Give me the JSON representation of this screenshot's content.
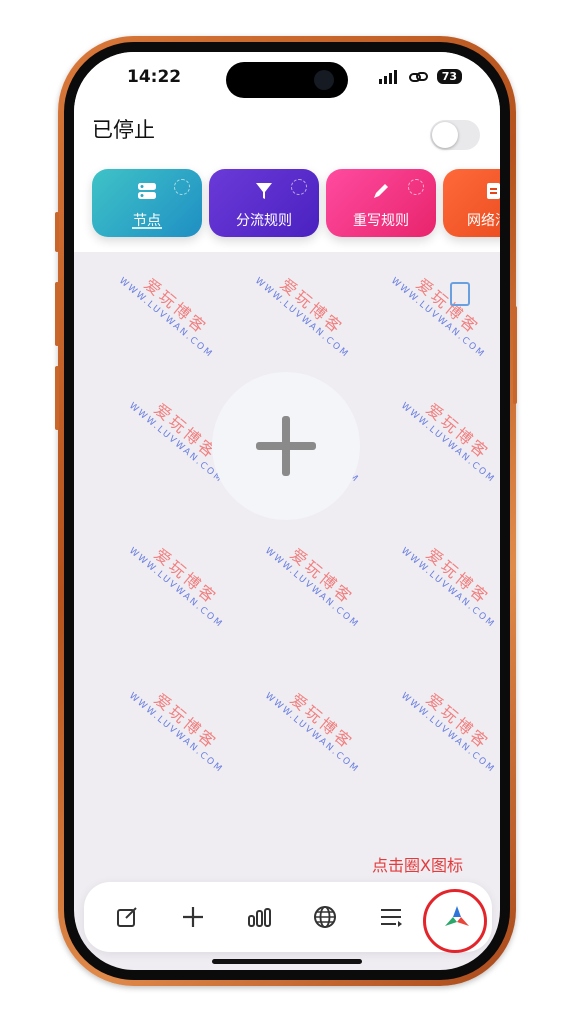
{
  "status_bar": {
    "time": "14:22",
    "battery": "73"
  },
  "header": {
    "title": "已停止",
    "toggle_on": false
  },
  "cards": [
    {
      "label": "节点",
      "icon": "server-icon"
    },
    {
      "label": "分流规则",
      "icon": "filter-icon"
    },
    {
      "label": "重写规则",
      "icon": "pencil-icon"
    },
    {
      "label": "网络活",
      "icon": "document-icon"
    }
  ],
  "watermark": {
    "cn": "爱玩博客",
    "en": "WWW.LUVWAN.COM"
  },
  "annotation": "点击圈X图标",
  "tabbar": [
    "edit-icon",
    "plus-icon",
    "bar-chart-icon",
    "globe-icon",
    "list-icon",
    "quantumult-x-icon"
  ],
  "colors": {
    "accent_red": "#e3242b",
    "nodes": "#1f8fc4",
    "filter": "#4a21c0",
    "rewrite": "#e8246c",
    "network": "#e44418"
  }
}
